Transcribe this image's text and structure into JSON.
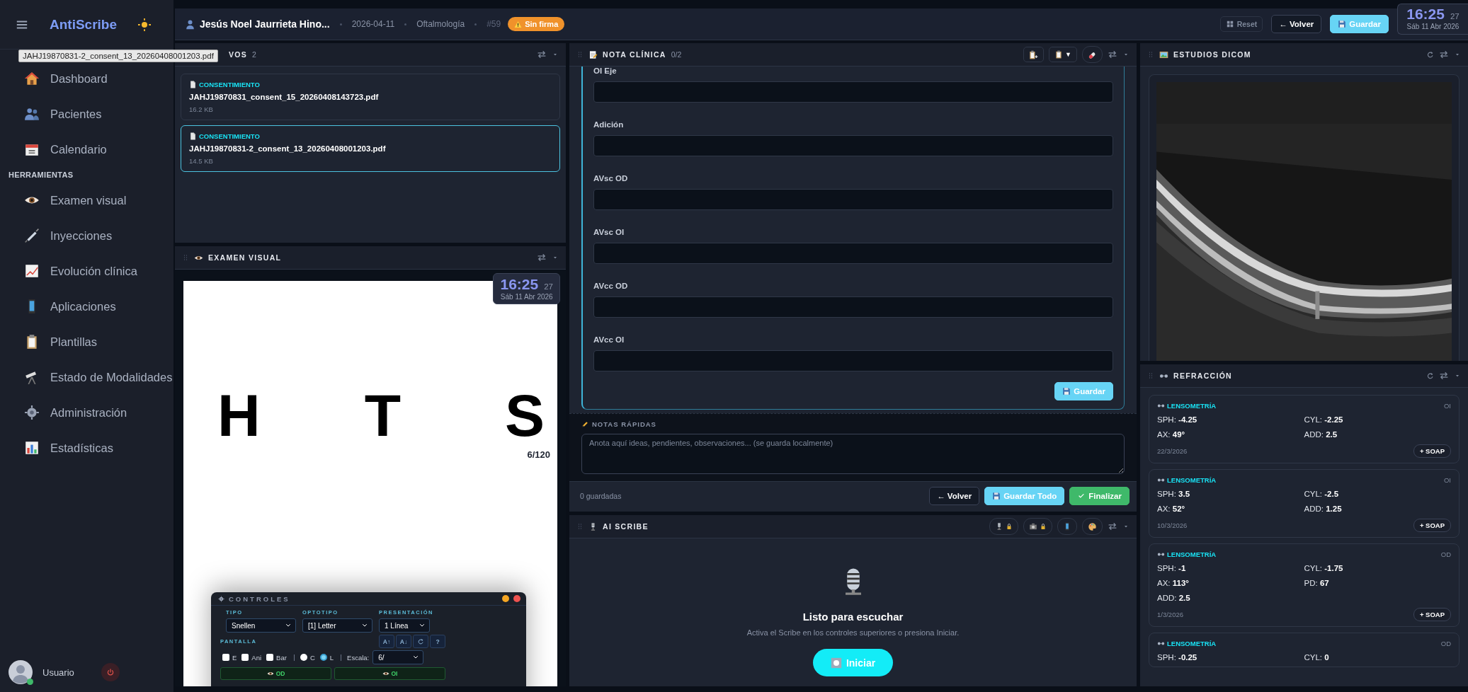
{
  "app": {
    "name": "AntiScribe"
  },
  "tooltip": {
    "text": "JAHJ19870831-2_consent_13_20260408001203.pdf"
  },
  "sidebar": {
    "nav": [
      {
        "label": "Dashboard",
        "selected": false
      },
      {
        "label": "Pacientes",
        "selected": false
      },
      {
        "label": "Calendario",
        "selected": false
      }
    ],
    "section": "HERRAMIENTAS",
    "tools": [
      {
        "label": "Examen visual",
        "selected": false
      },
      {
        "label": "Inyecciones",
        "selected": false
      },
      {
        "label": "Evolución clínica",
        "selected": false
      },
      {
        "label": "Aplicaciones",
        "selected": false
      },
      {
        "label": "Plantillas",
        "selected": false
      },
      {
        "label": "Estado de Modalidades",
        "selected": false
      },
      {
        "label": "Administración",
        "selected": false
      },
      {
        "label": "Estadísticas",
        "selected": false
      }
    ],
    "user": {
      "name": "Usuario",
      "online": true
    }
  },
  "header": {
    "patient": "Jesús Noel Jaurrieta Hino...",
    "date": "2026-04-11",
    "specialty": "Oftalmología",
    "number": "#59",
    "badge": "Sin firma",
    "buttons": [
      {
        "label": "Reset",
        "kind": "ghost"
      },
      {
        "label": "← Volver",
        "kind": "outline"
      },
      {
        "label": "Guardar",
        "kind": "primary"
      }
    ]
  },
  "clock": {
    "time": "16:25",
    "seconds": "27",
    "date": "Sáb 11 Abr 2026"
  },
  "files_panel": {
    "title": "VOS",
    "count": "2",
    "files": [
      {
        "type": "CONSENTIMIENTO",
        "name": "JAHJ19870831_consent_15_20260408143723.pdf",
        "size": "16.2 KB",
        "selected": false
      },
      {
        "type": "CONSENTIMIENTO",
        "name": "JAHJ19870831-2_consent_13_20260408001203.pdf",
        "size": "14.5 KB",
        "selected": true
      }
    ]
  },
  "visual_panel": {
    "title": "EXAMEN VISUAL",
    "letters": [
      "H",
      "T",
      "S"
    ],
    "acuity": "6/120",
    "overlay_clock": {
      "time": "16:25",
      "seconds": "27",
      "date": "Sáb 11 Abr 2026"
    },
    "controls": {
      "title": "CONTROLES",
      "selects": [
        {
          "label": "TIPO",
          "value": "Snellen"
        },
        {
          "label": "OPTOTIPO",
          "value": "[1] Letter"
        },
        {
          "label": "PRESENTACIÓN",
          "value": "1 Línea"
        }
      ],
      "section": "PANTALLA",
      "tools": [
        {
          "kind": "text",
          "label": "A↑"
        },
        {
          "kind": "text",
          "label": "A↓"
        },
        {
          "kind": "reset"
        },
        {
          "kind": "text",
          "label": "?"
        }
      ],
      "checks": [
        {
          "label": "E",
          "checked": false
        },
        {
          "label": "Ani",
          "checked": false
        },
        {
          "label": "Bar",
          "checked": false
        }
      ],
      "radios": [
        {
          "label": "C",
          "selected": false
        },
        {
          "label": "L",
          "selected": true
        }
      ],
      "scale": {
        "label": "Escala:",
        "value": "6/"
      },
      "eyes": [
        "OD",
        "OI"
      ]
    }
  },
  "note_panel": {
    "title": "NOTA CLÍNICA",
    "count": "0/2",
    "menu": "▼",
    "fields": [
      {
        "label": "OI Eje"
      },
      {
        "label": "Adición"
      },
      {
        "label": "AVsc OD"
      },
      {
        "label": "AVsc OI"
      },
      {
        "label": "AVcc OD"
      },
      {
        "label": "AVcc OI"
      }
    ],
    "save": "Guardar"
  },
  "quick_notes": {
    "title": "NOTAS RÁPIDAS",
    "placeholder": "Anota aquí ideas, pendientes, observaciones... (se guarda localmente)"
  },
  "footer": {
    "saved": "0 guardadas",
    "buttons": [
      {
        "label": "← Volver",
        "kind": "outline"
      },
      {
        "label": "Guardar Todo",
        "kind": "primary"
      },
      {
        "label": "Finalizar",
        "kind": "success"
      }
    ]
  },
  "scribe_panel": {
    "title": "AI SCRIBE",
    "heading": "Listo para escuchar",
    "hint": "Activa el Scribe en los controles superiores o presiona Iniciar.",
    "action": "Iniciar"
  },
  "dicom_panel": {
    "title": "ESTUDIOS DICOM"
  },
  "refraction_panel": {
    "title": "REFRACCIÓN",
    "cards": [
      {
        "title": "LENSOMETRÍA",
        "eye": "OI",
        "fields": [
          {
            "label": "SPH:",
            "value": "-4.25"
          },
          {
            "label": "CYL:",
            "value": "-2.25"
          },
          {
            "label": "AX:",
            "value": "49°"
          },
          {
            "label": "ADD:",
            "value": "2.5"
          }
        ],
        "date": "22/3/2026",
        "action": "+ SOAP"
      },
      {
        "title": "LENSOMETRÍA",
        "eye": "OI",
        "fields": [
          {
            "label": "SPH:",
            "value": "3.5"
          },
          {
            "label": "CYL:",
            "value": "-2.5"
          },
          {
            "label": "AX:",
            "value": "52°"
          },
          {
            "label": "ADD:",
            "value": "1.25"
          }
        ],
        "date": "10/3/2026",
        "action": "+ SOAP"
      },
      {
        "title": "LENSOMETRÍA",
        "eye": "OD",
        "fields": [
          {
            "label": "SPH:",
            "value": "-1"
          },
          {
            "label": "CYL:",
            "value": "-1.75"
          },
          {
            "label": "AX:",
            "value": "113°"
          },
          {
            "label": "PD:",
            "value": "67"
          },
          {
            "label": "ADD:",
            "value": "2.5"
          }
        ],
        "date": "1/3/2026",
        "action": "+ SOAP"
      },
      {
        "title": "LENSOMETRÍA",
        "eye": "OD",
        "fields": [
          {
            "label": "SPH:",
            "value": "-0.25"
          },
          {
            "label": "CYL:",
            "value": "0"
          }
        ]
      }
    ]
  }
}
